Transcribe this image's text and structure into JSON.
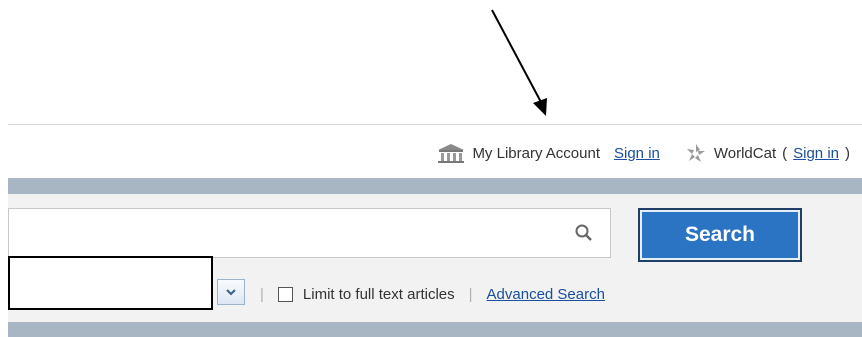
{
  "account": {
    "library_label": "My Library Account",
    "sign_in": "Sign in",
    "worldcat_label": "WorldCat",
    "worldcat_open_paren": "(",
    "worldcat_sign_in": "Sign in",
    "worldcat_close_paren": ")"
  },
  "search": {
    "input_value": "",
    "button_label": "Search"
  },
  "options": {
    "separator": "|",
    "full_text_label": "Limit to full text articles",
    "full_text_checked": false,
    "advanced_label": "Advanced Search"
  },
  "icons": {
    "library": "library-building-icon",
    "worldcat": "worldcat-logo-icon",
    "search": "magnifier-icon",
    "dropdown": "chevron-down-icon"
  },
  "colors": {
    "link": "#1a4fa0",
    "search_button": "#2b74c4",
    "band": "#a8b6c3",
    "panel": "#f2f2f2"
  }
}
